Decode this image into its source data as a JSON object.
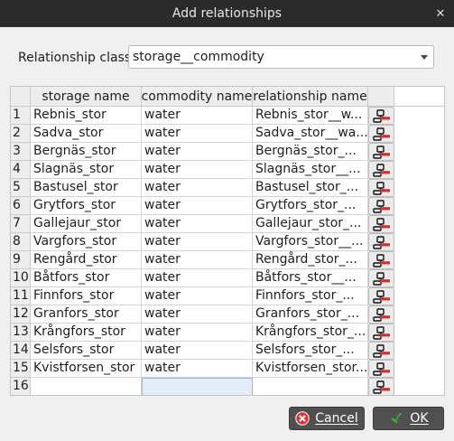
{
  "window": {
    "title": "Add relationships",
    "close_glyph": "✕"
  },
  "relationship_class": {
    "label": "Relationship class",
    "value": "storage__commodity"
  },
  "table": {
    "headers": [
      "storage name",
      "commodity name",
      "relationship name"
    ],
    "rows": [
      {
        "n": "1",
        "storage": "Rebnis_stor",
        "commodity": "water",
        "relationship": "Rebnis_stor__w..."
      },
      {
        "n": "2",
        "storage": "Sadva_stor",
        "commodity": "water",
        "relationship": "Sadva_stor__wa..."
      },
      {
        "n": "3",
        "storage": "Bergnäs_stor",
        "commodity": "water",
        "relationship": "Bergnäs_stor_..."
      },
      {
        "n": "4",
        "storage": "Slagnäs_stor",
        "commodity": "water",
        "relationship": "Slagnäs_stor__..."
      },
      {
        "n": "5",
        "storage": "Bastusel_stor",
        "commodity": "water",
        "relationship": "Bastusel_stor_..."
      },
      {
        "n": "6",
        "storage": "Grytfors_stor",
        "commodity": "water",
        "relationship": "Grytfors_stor_..."
      },
      {
        "n": "7",
        "storage": "Gallejaur_stor",
        "commodity": "water",
        "relationship": "Gallejaur_stor_..."
      },
      {
        "n": "8",
        "storage": "Vargfors_stor",
        "commodity": "water",
        "relationship": "Vargfors_stor__..."
      },
      {
        "n": "9",
        "storage": "Rengård_stor",
        "commodity": "water",
        "relationship": "Rengård_stor_..."
      },
      {
        "n": "10",
        "storage": "Båtfors_stor",
        "commodity": "water",
        "relationship": "Båtfors_stor__..."
      },
      {
        "n": "11",
        "storage": "Finnfors_stor",
        "commodity": "water",
        "relationship": "Finnfors_stor_..."
      },
      {
        "n": "12",
        "storage": "Granfors_stor",
        "commodity": "water",
        "relationship": "Granfors_stor_..."
      },
      {
        "n": "13",
        "storage": "Krångfors_stor",
        "commodity": "water",
        "relationship": "Krångfors_stor_..."
      },
      {
        "n": "14",
        "storage": "Selsfors_stor",
        "commodity": "water",
        "relationship": "Selsfors_stor_..."
      },
      {
        "n": "15",
        "storage": "Kvistforsen_stor",
        "commodity": "water",
        "relationship": "Kvistforsen_stor..."
      },
      {
        "n": "16",
        "storage": "",
        "commodity": "",
        "relationship": ""
      }
    ],
    "remove_icon": "remove-row-icon"
  },
  "buttons": {
    "cancel_label": "Cancel",
    "ok_label": "OK"
  },
  "colors": {
    "titlebar": "#2b2b2b",
    "button": "#505050",
    "cancel_icon": "#d9363e",
    "ok_icon": "#3fa535",
    "remove_icon": "#e0262b"
  }
}
